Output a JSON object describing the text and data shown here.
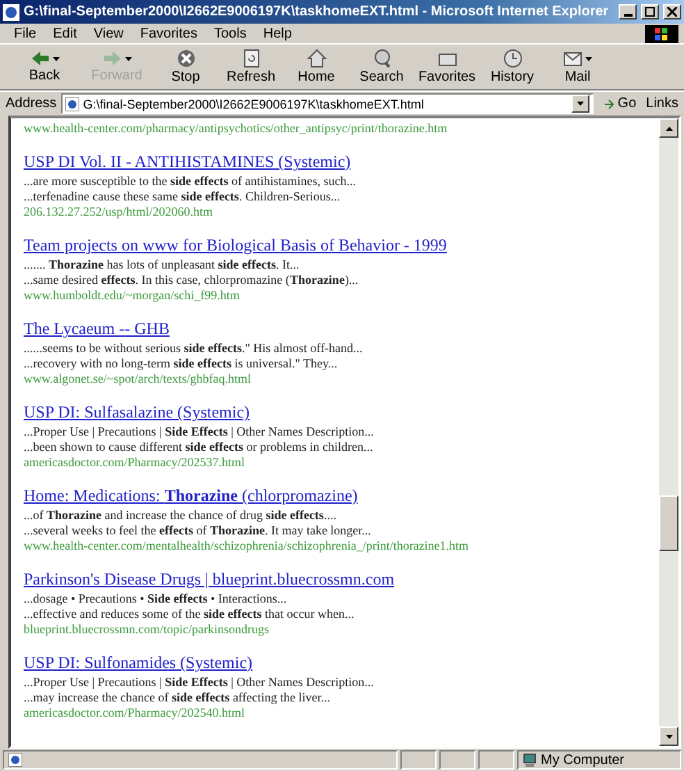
{
  "window": {
    "title": "G:\\final-September2000\\I2662E9006197K\\taskhomeEXT.html - Microsoft Internet Explorer"
  },
  "menu": [
    "File",
    "Edit",
    "View",
    "Favorites",
    "Tools",
    "Help"
  ],
  "toolbar": {
    "buttons": [
      {
        "label": "Back",
        "kind": "back",
        "disabled": false,
        "dropdown": true
      },
      {
        "label": "Forward",
        "kind": "forward",
        "disabled": true,
        "dropdown": true
      },
      {
        "label": "Stop",
        "kind": "stop",
        "disabled": false,
        "dropdown": false
      },
      {
        "label": "Refresh",
        "kind": "refresh",
        "disabled": false,
        "dropdown": false
      },
      {
        "label": "Home",
        "kind": "home",
        "disabled": false,
        "dropdown": false
      },
      {
        "label": "Search",
        "kind": "search",
        "disabled": false,
        "dropdown": false
      },
      {
        "label": "Favorites",
        "kind": "favorites",
        "disabled": false,
        "dropdown": false
      },
      {
        "label": "History",
        "kind": "history",
        "disabled": false,
        "dropdown": false
      },
      {
        "label": "Mail",
        "kind": "mail",
        "disabled": false,
        "dropdown": true
      }
    ]
  },
  "address_bar": {
    "label": "Address",
    "value": "G:\\final-September2000\\I2662E9006197K\\taskhomeEXT.html",
    "go": "Go",
    "links": "Links"
  },
  "content": {
    "top_url": "www.health-center.com/pharmacy/antipsychotics/other_antipsyc/print/thorazine.htm",
    "results": [
      {
        "title": "USP DI Vol. II - ANTIHISTAMINES (Systemic)",
        "snippets": [
          "...are more susceptible to the **side effects** of antihistamines, such...",
          "...terfenadine cause these same **side effects**. Children-Serious..."
        ],
        "url": "206.132.27.252/usp/html/202060.htm"
      },
      {
        "title": "Team projects on www for Biological Basis of Behavior - 1999",
        "snippets": [
          "....... **Thorazine** has lots of unpleasant **side effects**. It...",
          "...same desired **effects**. In this case, chlorpromazine (**Thorazine**)..."
        ],
        "url": "www.humboldt.edu/~morgan/schi_f99.htm"
      },
      {
        "title": "The Lycaeum -- GHB",
        "snippets": [
          "......seems to be without serious **side effects**.\" His almost off-hand...",
          "...recovery with no long-term **side effects** is universal.\" They..."
        ],
        "url": "www.algonet.se/~spot/arch/texts/ghbfaq.html"
      },
      {
        "title": "USP DI: Sulfasalazine (Systemic)",
        "snippets": [
          "...Proper Use | Precautions | **Side Effects** | Other Names Description...",
          "...been shown to cause different **side effects** or problems in children..."
        ],
        "url": "americasdoctor.com/Pharmacy/202537.html"
      },
      {
        "title": "Home: Medications: **Thorazine** (chlorpromazine)",
        "snippets": [
          "...of **Thorazine** and increase the chance of drug **side effects**....",
          "...several weeks to feel the **effects** of **Thorazine**. It may take longer..."
        ],
        "url": "www.health-center.com/mentalhealth/schizophrenia/schizophrenia_/print/thorazine1.htm"
      },
      {
        "title": "Parkinson's Disease Drugs | blueprint.bluecrossmn.com",
        "snippets": [
          "...dosage • Precautions • **Side effects** • Interactions...",
          "...effective and reduces some of the **side effects** that occur when..."
        ],
        "url": "blueprint.bluecrossmn.com/topic/parkinsondrugs"
      },
      {
        "title": "USP DI: Sulfonamides (Systemic)",
        "snippets": [
          "...Proper Use | Precautions | **Side Effects** | Other Names Description...",
          "...may increase the chance of **side effects** affecting the liver..."
        ],
        "url": "americasdoctor.com/Pharmacy/202540.html"
      }
    ]
  },
  "status_bar": {
    "zone": "My Computer"
  }
}
